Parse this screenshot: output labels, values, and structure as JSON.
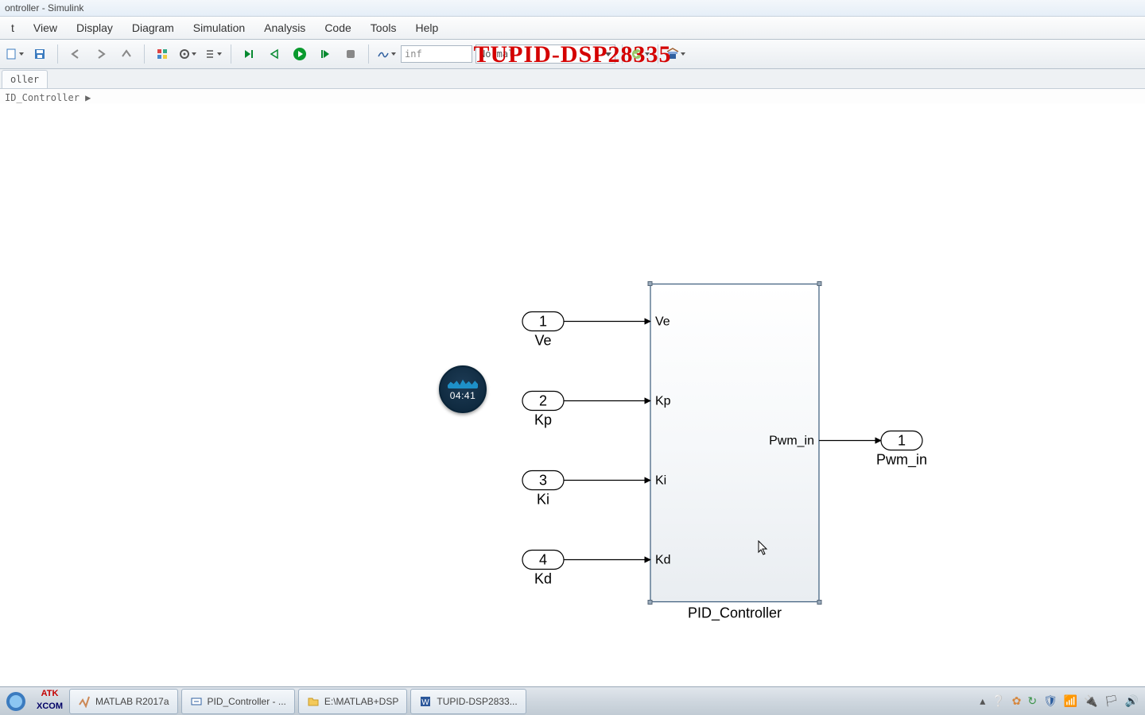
{
  "window": {
    "title": "ontroller - Simulink"
  },
  "menu": {
    "items": [
      "t",
      "View",
      "Display",
      "Diagram",
      "Simulation",
      "Analysis",
      "Code",
      "Tools",
      "Help"
    ]
  },
  "toolbar": {
    "stop_time_value": "inf",
    "mode_value": "Normal",
    "watermark": "TUPID-DSP28335"
  },
  "tab": {
    "label": "oller"
  },
  "breadcrumb": {
    "text": "ID_Controller ▶"
  },
  "recorder": {
    "time": "04:41"
  },
  "diagram": {
    "inputs": [
      {
        "num": "1",
        "name": "Ve"
      },
      {
        "num": "2",
        "name": "Kp"
      },
      {
        "num": "3",
        "name": "Ki"
      },
      {
        "num": "4",
        "name": "Kd"
      }
    ],
    "block": {
      "input_labels": [
        "Ve",
        "Kp",
        "Ki",
        "Kd"
      ],
      "output_label": "Pwm_in",
      "name": "PID_Controller"
    },
    "outputs": [
      {
        "num": "1",
        "name": "Pwm_in"
      }
    ]
  },
  "taskbar": {
    "items": [
      {
        "label": "",
        "icon": "start"
      },
      {
        "label": "",
        "icon": "atk"
      },
      {
        "label": "MATLAB R2017a",
        "icon": "matlab"
      },
      {
        "label": "PID_Controller - ...",
        "icon": "simulink"
      },
      {
        "label": "E:\\MATLAB+DSP",
        "icon": "folder"
      },
      {
        "label": "TUPID-DSP2833...",
        "icon": "word"
      }
    ]
  }
}
